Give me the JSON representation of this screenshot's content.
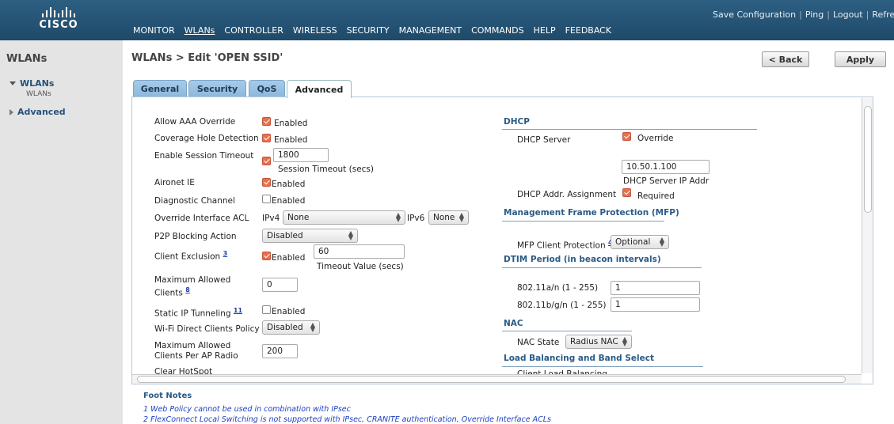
{
  "header": {
    "brand": "CISCO",
    "nav": [
      "MONITOR",
      "WLANs",
      "CONTROLLER",
      "WIRELESS",
      "SECURITY",
      "MANAGEMENT",
      "COMMANDS",
      "HELP",
      "FEEDBACK"
    ],
    "links": {
      "save": "Save Configuration",
      "sep": "|",
      "ping": "Ping",
      "logout": "Logout",
      "refresh": "Refresh"
    }
  },
  "sidebar": {
    "title": "WLANs",
    "group_wlans": "WLANs",
    "sub_wlans": "WLANs",
    "group_advanced": "Advanced"
  },
  "page": {
    "title": "WLANs > Edit  'OPEN SSID'",
    "back_label": "< Back",
    "apply_label": "Apply"
  },
  "tabs": [
    "General",
    "Security",
    "QoS",
    "Advanced"
  ],
  "left": {
    "allow_aaa": {
      "label": "Allow AAA Override",
      "checked": true,
      "text": "Enabled"
    },
    "coverage_hole": {
      "label": "Coverage Hole Detection",
      "checked": true,
      "text": "Enabled"
    },
    "session_timeout": {
      "label": "Enable Session Timeout",
      "checked": true,
      "value": "1800",
      "sublabel": "Session Timeout (secs)"
    },
    "aironet": {
      "label": "Aironet IE",
      "checked": true,
      "text": "Enabled"
    },
    "diagnostic": {
      "label": "Diagnostic Channel",
      "checked": false,
      "text": "Enabled"
    },
    "override_acl": {
      "label": "Override Interface ACL",
      "ipv4_label": "IPv4",
      "ipv4_value": "None",
      "ipv6_label": "IPv6",
      "ipv6_value": "None"
    },
    "p2p": {
      "label": "P2P Blocking Action",
      "value": "Disabled"
    },
    "client_exclusion": {
      "label": "Client Exclusion",
      "footnote": "3",
      "checked": true,
      "text": "Enabled",
      "value": "60",
      "sublabel": "Timeout Value (secs)"
    },
    "max_clients": {
      "label_line1": "Maximum Allowed",
      "label_line2": "Clients",
      "footnote": "8",
      "value": "0"
    },
    "static_ip": {
      "label": "Static IP Tunneling",
      "footnote": "11",
      "checked": false,
      "text": "Enabled"
    },
    "wifi_direct": {
      "label": "Wi-Fi Direct Clients Policy",
      "value": "Disabled"
    },
    "max_per_ap": {
      "label_line1": "Maximum Allowed",
      "label_line2": "Clients Per AP Radio",
      "value": "200"
    },
    "hotspot": {
      "label": "Clear HotSpot"
    }
  },
  "right": {
    "dhcp_header": "DHCP",
    "dhcp_server": {
      "label": "DHCP Server",
      "checked": true,
      "text": "Override",
      "value": "10.50.1.100",
      "sublabel": "DHCP Server IP Addr"
    },
    "dhcp_assign": {
      "label": "DHCP Addr. Assignment",
      "checked": true,
      "text": "Required"
    },
    "mfp_header": "Management Frame Protection (MFP)",
    "mfp": {
      "label": "MFP Client Protection",
      "footnote": "4",
      "value": "Optional"
    },
    "dtim_header": "DTIM Period (in beacon intervals)",
    "dtim_a": {
      "label": "802.11a/n (1 - 255)",
      "value": "1"
    },
    "dtim_b": {
      "label": "802.11b/g/n (1 - 255)",
      "value": "1"
    },
    "nac_header": "NAC",
    "nac": {
      "label": "NAC State",
      "value": "Radius NAC"
    },
    "lb_header": "Load Balancing and Band Select",
    "lb": {
      "label": "Client Load Balancing"
    }
  },
  "footnotes": {
    "title": "Foot Notes",
    "line1": "1 Web Policy cannot be used in combination with IPsec",
    "line2": "2 FlexConnect Local Switching is not supported with IPsec, CRANITE authentication, Override Interface ACLs"
  },
  "colors": {
    "banner": "#2d5f82",
    "tab": "#8ab7dd",
    "checked": "#e96f4e",
    "header_text": "#2a5a86"
  }
}
